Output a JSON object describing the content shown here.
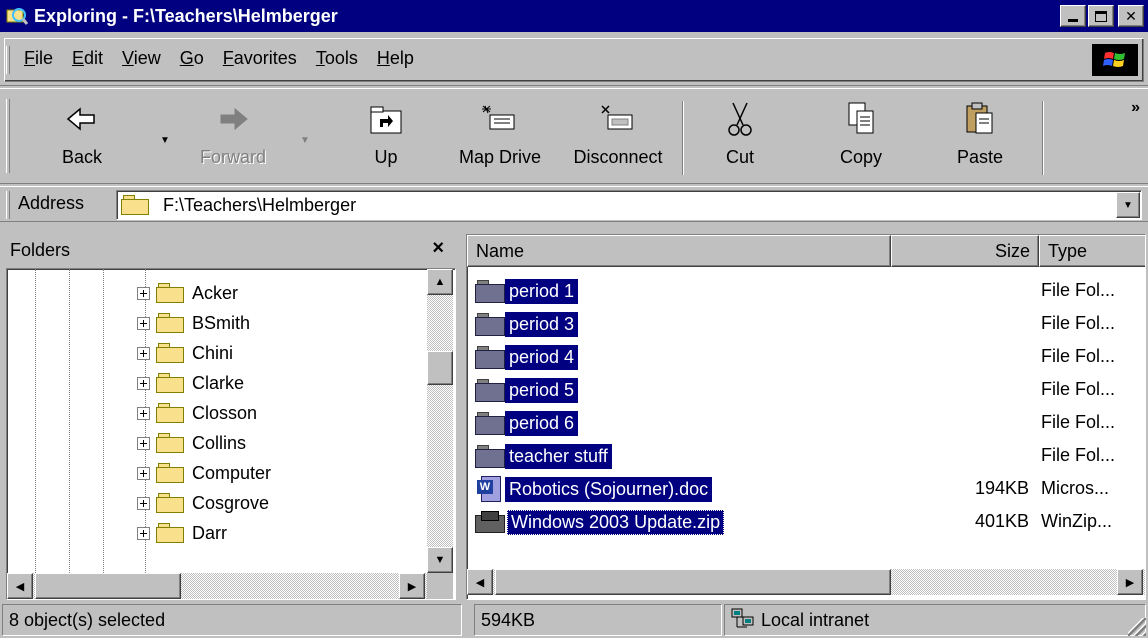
{
  "window": {
    "title": "Exploring - F:\\Teachers\\Helmberger",
    "icon": "explorer-icon",
    "controls": [
      "minimize",
      "maximize",
      "close"
    ]
  },
  "menu": {
    "items": [
      "File",
      "Edit",
      "View",
      "Go",
      "Favorites",
      "Tools",
      "Help"
    ]
  },
  "toolbar": {
    "back": "Back",
    "forward": "Forward",
    "up": "Up",
    "map_drive": "Map Drive",
    "disconnect": "Disconnect",
    "cut": "Cut",
    "copy": "Copy",
    "paste": "Paste",
    "more": "»"
  },
  "address": {
    "label": "Address",
    "value": "F:\\Teachers\\Helmberger"
  },
  "folders": {
    "title": "Folders",
    "close": "×",
    "items": [
      "Acker",
      "BSmith",
      "Chini",
      "Clarke",
      "Closson",
      "Collins",
      "Computer",
      "Cosgrove",
      "Darr"
    ]
  },
  "files": {
    "columns": {
      "name": "Name",
      "size": "Size",
      "type": "Type"
    },
    "rows": [
      {
        "name": "period 1",
        "size": "",
        "type": "File Fol...",
        "icon": "folder-icon"
      },
      {
        "name": "period 3",
        "size": "",
        "type": "File Fol...",
        "icon": "folder-icon"
      },
      {
        "name": "period 4",
        "size": "",
        "type": "File Fol...",
        "icon": "folder-icon"
      },
      {
        "name": "period 5",
        "size": "",
        "type": "File Fol...",
        "icon": "folder-icon"
      },
      {
        "name": "period 6",
        "size": "",
        "type": "File Fol...",
        "icon": "folder-icon"
      },
      {
        "name": "teacher stuff",
        "size": "",
        "type": "File Fol...",
        "icon": "folder-icon"
      },
      {
        "name": "Robotics (Sojourner).doc",
        "size": "194KB",
        "type": "Micros...",
        "icon": "word-doc-icon"
      },
      {
        "name": "Windows 2003 Update.zip",
        "size": "401KB",
        "type": "WinZip...",
        "icon": "zip-file-icon"
      }
    ]
  },
  "status": {
    "selected": "8 object(s) selected",
    "size": "594KB",
    "zone": "Local intranet"
  },
  "colors": {
    "titlebar": "#000080",
    "selection": "#000080",
    "face": "#c0c0c0"
  }
}
